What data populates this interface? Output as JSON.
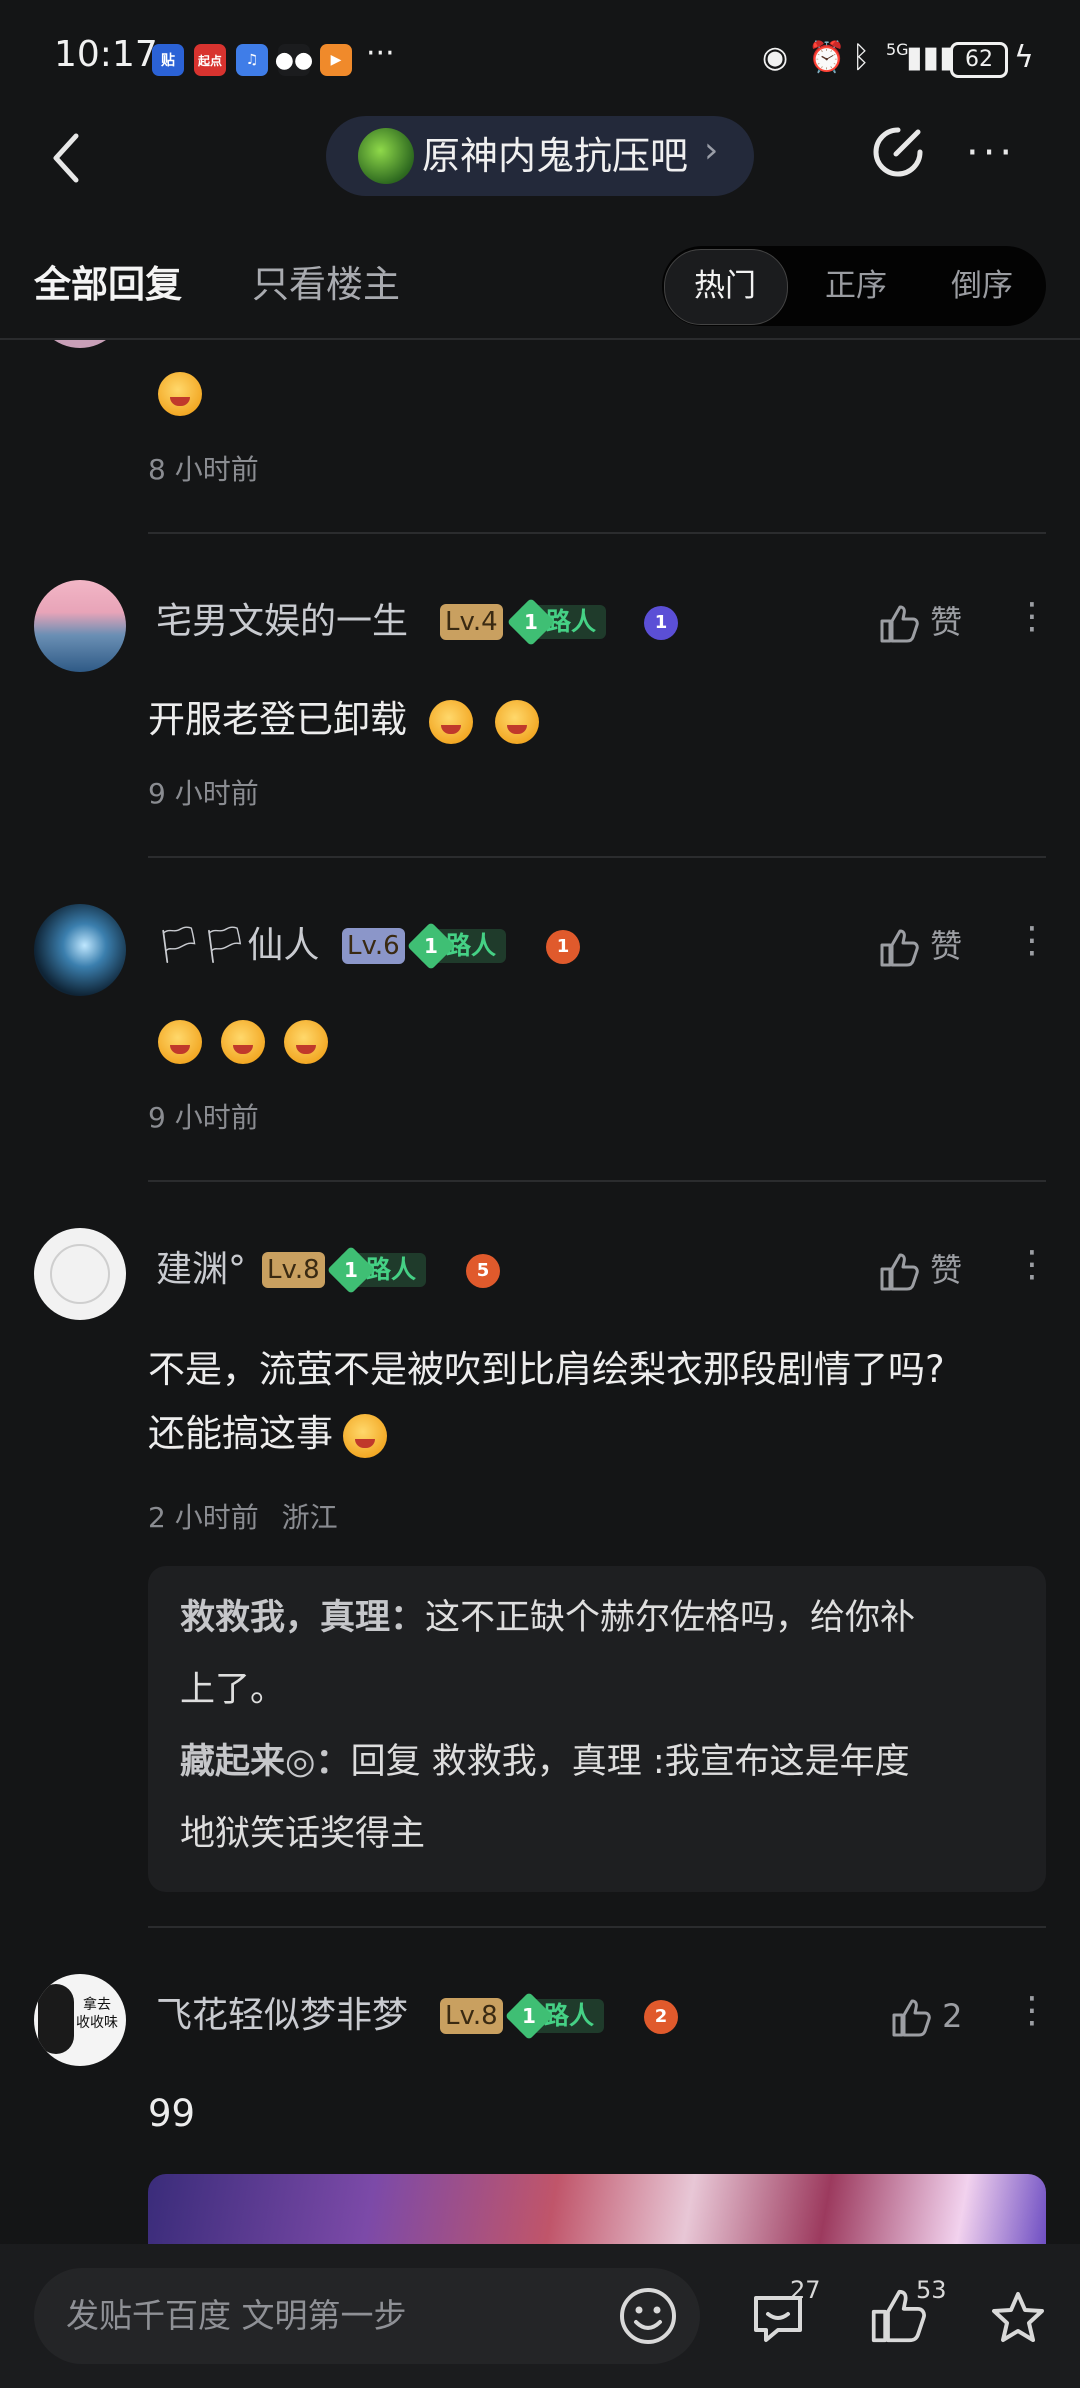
{
  "status_bar": {
    "time": "10:17",
    "apps": [
      "贴",
      "起点",
      "♫",
      "微信",
      "▶"
    ],
    "more": "···",
    "network": "5G",
    "battery": "62"
  },
  "nav": {
    "forum_name": "原神内鬼抗压吧",
    "forum_arrow": "›",
    "more": "···"
  },
  "tabs": {
    "all_replies": "全部回复",
    "op_only": "只看楼主",
    "sort_options": [
      "热门",
      "正序",
      "倒序"
    ],
    "sort_active": "热门"
  },
  "comments": [
    {
      "content_emojis": 1,
      "time": "8 小时前"
    },
    {
      "username": "宅男文娱的一生",
      "level": "Lv.4",
      "rank_num": "1",
      "rank_label": "路人",
      "medal": "1",
      "medal_color": "#5b4fd6",
      "like_label": "赞",
      "text": "开服老登已卸载",
      "time": "9 小时前"
    },
    {
      "username": "🏳🏳仙人",
      "level": "Lv.6",
      "rank_num": "1",
      "rank_label": "路人",
      "medal": "1",
      "medal_color": "#e05a2c",
      "like_label": "赞",
      "content_emojis": 3,
      "time": "9 小时前"
    },
    {
      "username": "建渊°",
      "level": "Lv.8",
      "rank_num": "1",
      "rank_label": "路人",
      "medal": "5",
      "medal_color": "#e05a2c",
      "like_label": "赞",
      "text_line1": "不是，流萤不是被吹到比肩绘梨衣那段剧情了吗?",
      "text_line2": "还能搞这事",
      "time": "2 小时前",
      "location": "浙江",
      "replies": [
        {
          "author": "救救我，真理",
          "sep": "：",
          "line1": "这不正缺个赫尔佐格吗，给你补",
          "line2": "上了。"
        },
        {
          "author": "藏起来◎",
          "sep": "：",
          "line1": "回复 救救我，真理 :我宣布这是年度",
          "line2": "地狱笑话奖得主"
        }
      ]
    },
    {
      "username": "飞花轻似梦非梦",
      "level": "Lv.8",
      "rank_num": "1",
      "rank_label": "路人",
      "medal": "2",
      "medal_color": "#e05a2c",
      "like_count": "2",
      "avatar_text": "拿去\n收收味",
      "text": "99"
    }
  ],
  "bottom_bar": {
    "placeholder": "发贴千百度 文明第一步",
    "comment_count": "27",
    "like_count": "53"
  },
  "colors": {
    "background": "#141516",
    "accent_green": "#45d185",
    "level_gold": "#c9a060",
    "level_blue": "#8b96c9"
  }
}
